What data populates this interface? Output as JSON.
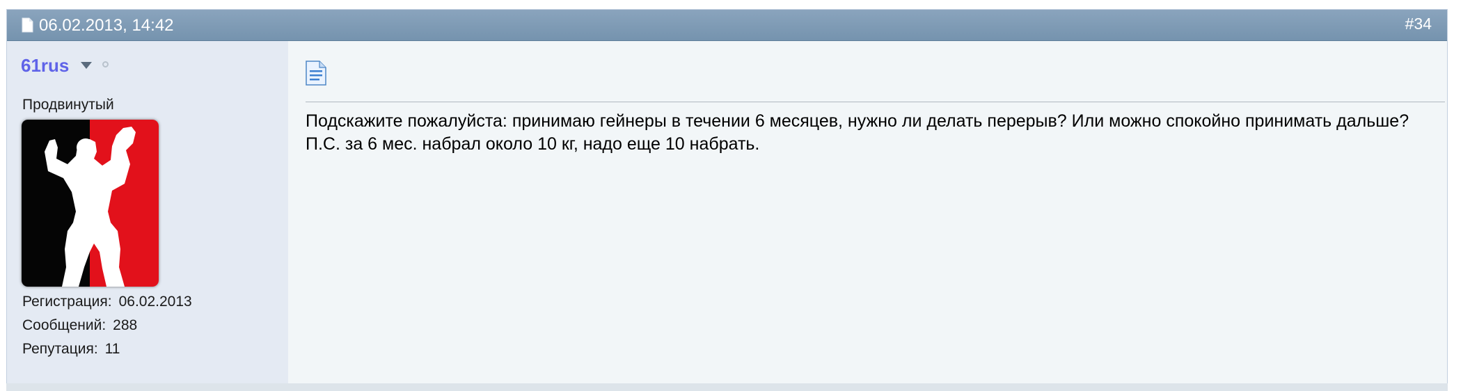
{
  "post": {
    "date": "06.02.2013, 14:42",
    "number": "#34",
    "author": {
      "username": "61rus",
      "title": "Продвинутый",
      "online_status": "offline",
      "avatar_icon": "bodybuilder-silhouette-avatar",
      "stats": [
        {
          "label": "Регистрация:",
          "value": "06.02.2013"
        },
        {
          "label": "Сообщений:",
          "value": "288"
        },
        {
          "label": "Репутация:",
          "value": "11"
        }
      ]
    },
    "body": {
      "line1": "Подскажите пожалуйста: принимаю гейнеры в течении 6 месяцев, нужно ли делать перерыв? Или можно спокойно принимать дальше?",
      "line2": "П.С. за 6 мес. набрал около 10 кг, надо еще 10 набрать."
    }
  },
  "colors": {
    "header_bg": "#7f9bb5",
    "username": "#5f63e8",
    "sidebar_bg": "#e4eaf3",
    "body_bg": "#f2f6f8",
    "avatar_red": "#e2111b"
  }
}
